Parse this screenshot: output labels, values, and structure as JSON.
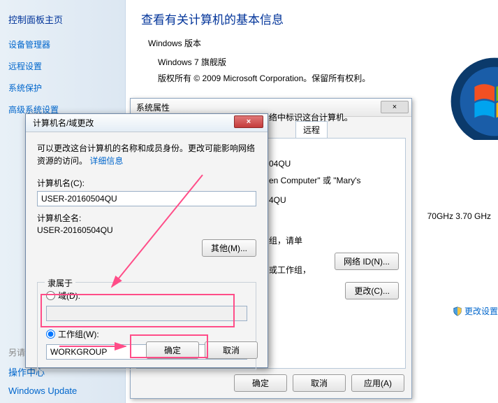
{
  "sidebar": {
    "title": "控制面板主页",
    "links": [
      "设备管理器",
      "远程设置",
      "系统保护",
      "高级系统设置"
    ],
    "bottom": {
      "seealso": "另请参阅",
      "action": "操作中心",
      "update": "Windows Update"
    }
  },
  "main": {
    "title": "查看有关计算机的基本信息",
    "edition_label": "Windows 版本",
    "edition": "Windows 7 旗舰版",
    "copyright": "版权所有 © 2009 Microsoft Corporation。保留所有权利。",
    "cpu": "70GHz   3.70 GHz",
    "change_settings": "更改设置"
  },
  "sysprops": {
    "title": "系统属性",
    "close": "×",
    "tabs": {
      "remote": "远程"
    },
    "desc_fragment": "络中标识这台计算机。",
    "id_fragment": "04QU",
    "example_fragment": "en Computer\" 或 \"Mary's",
    "qu_fragment": "4QU",
    "workgroup_hint1": "组，请单",
    "workgroup_hint2": "或工作组，",
    "netid_btn": "网络 ID(N)...",
    "change_btn": "更改(C)...",
    "ok": "确定",
    "cancel": "取消",
    "apply": "应用(A)"
  },
  "dialog": {
    "title": "计算机名/域更改",
    "close": "×",
    "desc": "可以更改这台计算机的名称和成员身份。更改可能影响网络资源的访问。",
    "details_link": "详细信息",
    "name_label": "计算机名(C):",
    "name_value": "USER-20160504QU",
    "fullname_label": "计算机全名:",
    "fullname_value": "USER-20160504QU",
    "other_btn": "其他(M)...",
    "memberof": "隶属于",
    "domain_label": "域(D):",
    "domain_value": "",
    "workgroup_label": "工作组(W):",
    "workgroup_value": "WORKGROUP",
    "ok": "确定",
    "cancel": "取消"
  }
}
